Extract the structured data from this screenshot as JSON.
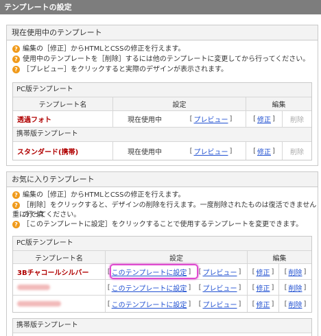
{
  "page_title": "テンプレートの設定",
  "current": {
    "title": "現在使用中のテンプレート",
    "notes": [
      "編集の［修正］からHTMLとCSSの修正を行えます。",
      "使用中のテンプレートを［削除］するには他のテンプレートに変更してから行ってください。",
      "［プレビュー］をクリックすると実際のデザインが表示されます。"
    ],
    "pc_section": "PC版テンプレート",
    "col_name": "テンプレート名",
    "col_setting": "設定",
    "col_edit": "編集",
    "pc_row": {
      "name": "透過フォト",
      "status": "現在使用中",
      "preview": "プレビュー",
      "edit": "修正",
      "delete": "削除"
    },
    "mobile_section": "携帯版テンプレート",
    "mobile_row": {
      "name": "スタンダード(携帯)",
      "status": "現在使用中",
      "preview": "プレビュー",
      "edit": "修正",
      "delete": "削除"
    }
  },
  "favorites": {
    "title": "お気に入りテンプレート",
    "notes": [
      "編集の［修正］からHTMLとCSSの修正を行えます。",
      "［削除］をクリックすると、デザインの削除を行えます。一度削除されたものは復活できませんので慎",
      "重に行ってください。",
      "［このテンプレートに設定］をクリックすることで使用するテンプレートを変更できます。"
    ],
    "pc_section": "PC版テンプレート",
    "col_name": "テンプレート名",
    "col_setting": "設定",
    "col_edit": "編集",
    "rows": [
      {
        "name": "3Bチャコールシルバー",
        "set": "このテンプレートに設定",
        "preview": "プレビュー",
        "edit": "修正",
        "delete": "削除"
      },
      {
        "name": "",
        "set": "このテンプレートに設定",
        "preview": "プレビュー",
        "edit": "修正",
        "delete": "削除"
      },
      {
        "name": "",
        "set": "このテンプレートに設定",
        "preview": "プレビュー",
        "edit": "修正",
        "delete": "削除"
      }
    ],
    "mobile_section": "携帯版テンプレート"
  },
  "colors": {
    "header_bg": "#7d7d7d",
    "link": "#1f4fd1",
    "template_name": "#b00000",
    "info_icon": "#f09a1a",
    "highlight": "#e04ad0"
  }
}
